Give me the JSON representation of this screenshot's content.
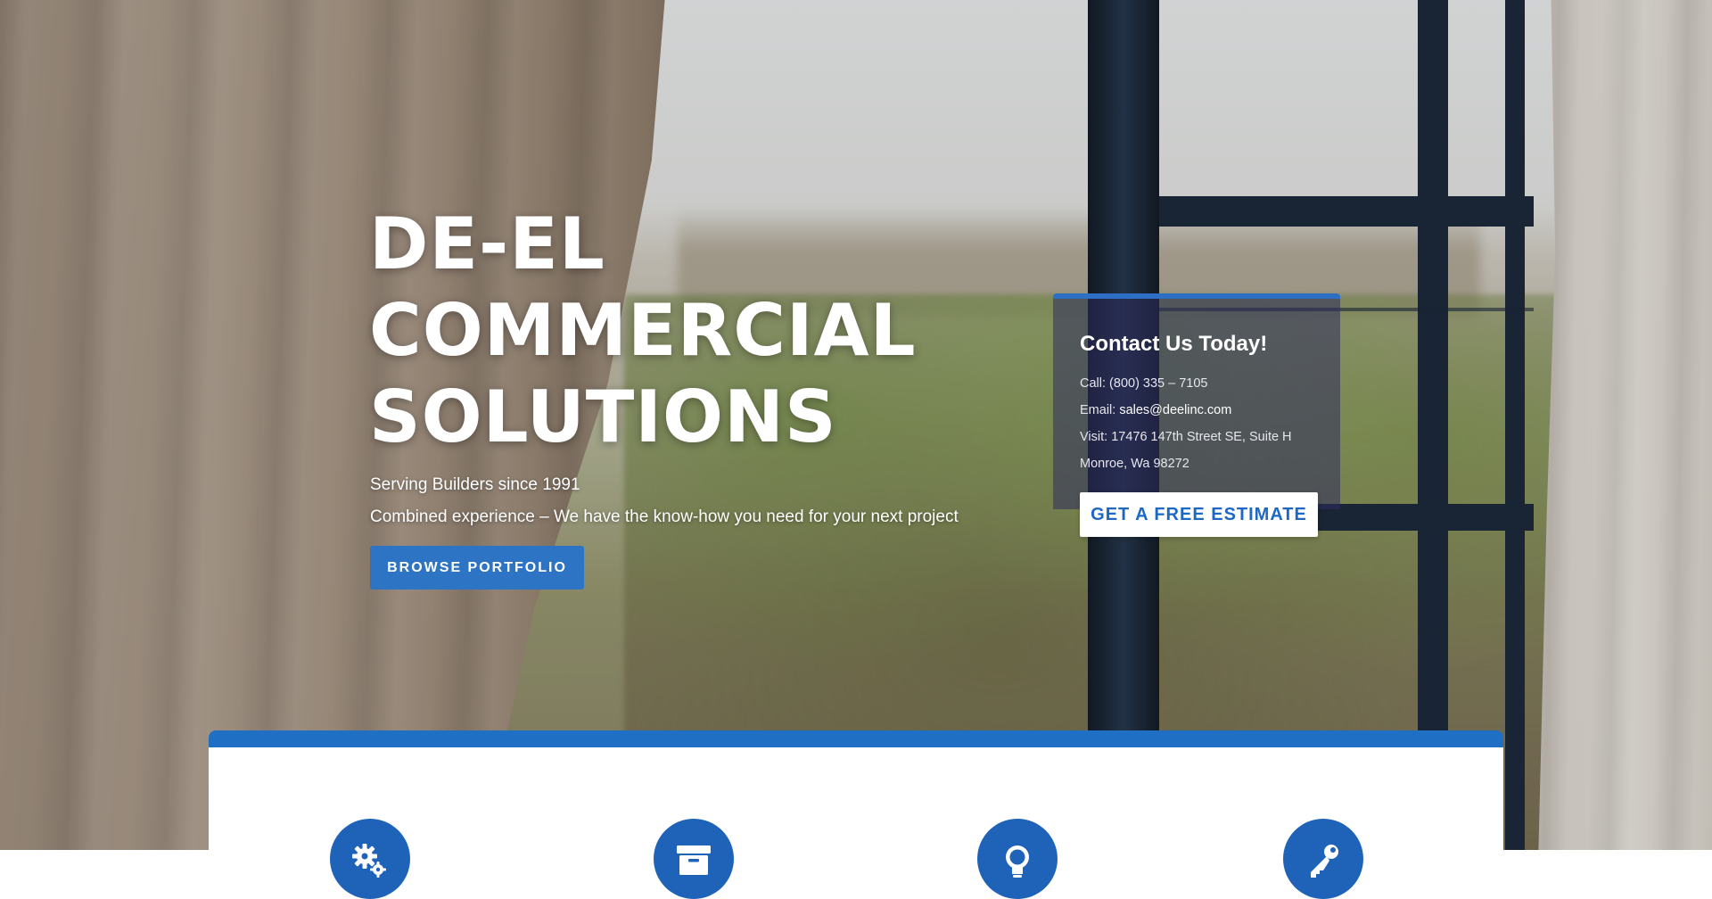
{
  "hero": {
    "headline": [
      "DE-EL",
      "COMMERCIAL",
      "SOLUTIONS"
    ],
    "tagline_1": "Serving Builders since 1991",
    "tagline_2": "Combined experience – We have the know-how you need for your next project",
    "browse_button": "BROWSE PORTFOLIO"
  },
  "contact": {
    "title": "Contact Us Today!",
    "call_label": "Call:",
    "call_value": "(800) 335 – 7105",
    "email_label": "Email:",
    "email_value": "sales@deelinc.com",
    "visit_label": "Visit:",
    "visit_value": "17476 147th Street SE, Suite H",
    "city_line": "Monroe, Wa 98272",
    "estimate_button": "GET A FREE ESTIMATE"
  },
  "features": {
    "icons": [
      "gears-icon",
      "archive-box-icon",
      "lightbulb-icon",
      "key-icon"
    ]
  },
  "colors": {
    "accent": "#1f6fc4",
    "button": "#2d74c4",
    "card": "#2e2c5c",
    "icon_circle": "#1e63b8"
  }
}
